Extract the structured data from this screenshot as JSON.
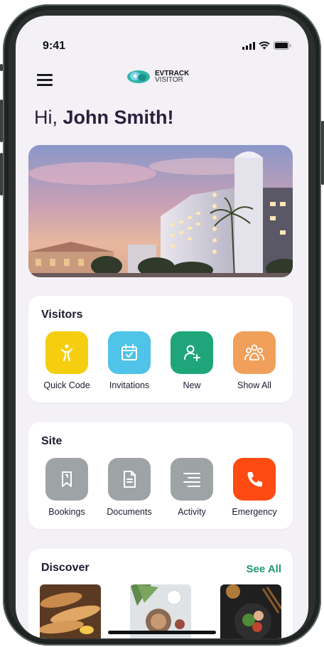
{
  "status": {
    "time": "9:41"
  },
  "brand": {
    "line1": "EVTRACK",
    "line2": "VISITOR"
  },
  "greeting": {
    "prefix": "Hi, ",
    "name": "John Smith!"
  },
  "visitors": {
    "title": "Visitors",
    "items": [
      {
        "label": "Quick Code",
        "icon": "person-icon",
        "color": "#f5cf0f"
      },
      {
        "label": "Invitations",
        "icon": "calendar-check-icon",
        "color": "#4fc3e8"
      },
      {
        "label": "New",
        "icon": "add-user-icon",
        "color": "#1ea67a"
      },
      {
        "label": "Show All",
        "icon": "group-icon",
        "color": "#f0a05a"
      }
    ]
  },
  "site": {
    "title": "Site",
    "items": [
      {
        "label": "Bookings",
        "icon": "bookmark-icon",
        "color": "#9ea3a6"
      },
      {
        "label": "Documents",
        "icon": "document-icon",
        "color": "#9ea3a6"
      },
      {
        "label": "Activity",
        "icon": "list-icon",
        "color": "#9ea3a6"
      },
      {
        "label": "Emergency",
        "icon": "phone-icon",
        "color": "#ff4a12"
      }
    ]
  },
  "discover": {
    "title": "Discover",
    "see_all": "See All"
  }
}
